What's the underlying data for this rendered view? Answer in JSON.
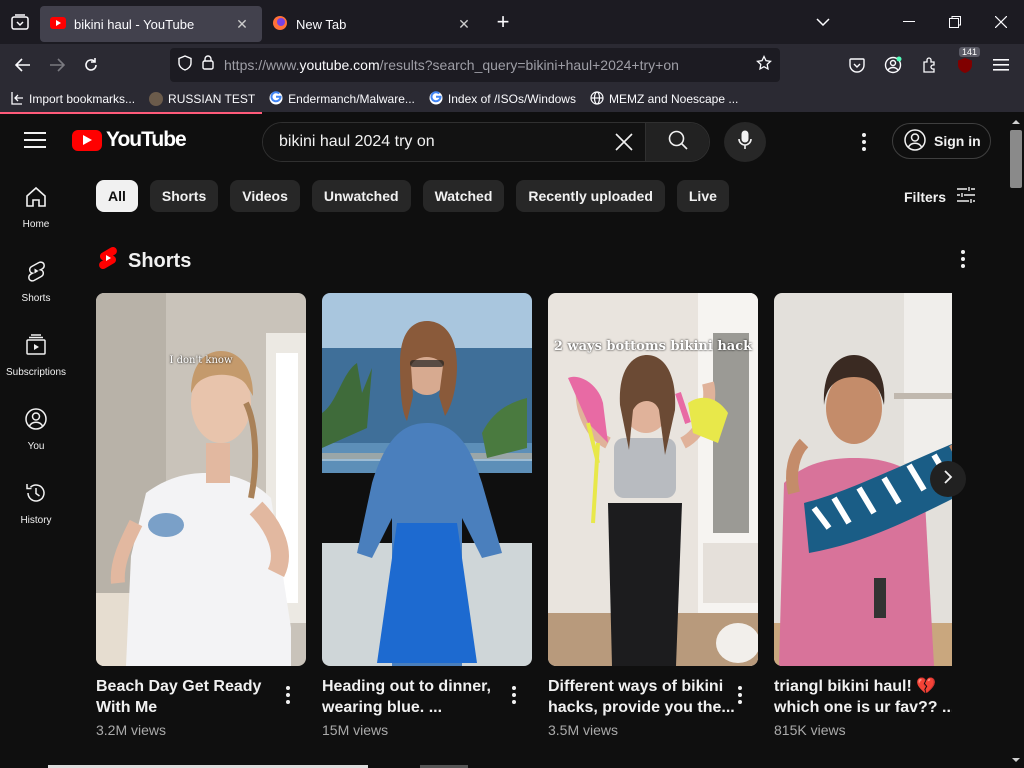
{
  "browser": {
    "tabs": [
      {
        "title": "bikini haul - YouTube",
        "active": true,
        "icon": "youtube-favicon"
      },
      {
        "title": "New Tab",
        "active": false,
        "icon": "firefox-favicon"
      }
    ],
    "url_prefix": "https://www.",
    "url_domain": "youtube.com",
    "url_rest": "/results?search_query=bikini+haul+2024+try+on",
    "extension_badge": "141",
    "bookmarks": [
      {
        "label": "Import bookmarks...",
        "icon": "import-icon"
      },
      {
        "label": "RUSSIAN TEST",
        "icon": "user-favicon"
      },
      {
        "label": "Endermanch/Malware...",
        "icon": "google-favicon"
      },
      {
        "label": "Index of /ISOs/Windows",
        "icon": "google-favicon"
      },
      {
        "label": "MEMZ and Noescape ...",
        "icon": "globe-icon"
      }
    ]
  },
  "youtube": {
    "logo_text": "YouTube",
    "search_value": "bikini haul 2024 try on",
    "sign_in_label": "Sign in",
    "sidebar": [
      {
        "label": "Home",
        "icon": "home-icon"
      },
      {
        "label": "Shorts",
        "icon": "shorts-icon"
      },
      {
        "label": "Subscriptions",
        "icon": "subscriptions-icon"
      },
      {
        "label": "You",
        "icon": "you-icon"
      },
      {
        "label": "History",
        "icon": "history-icon"
      }
    ],
    "chips": [
      "All",
      "Shorts",
      "Videos",
      "Unwatched",
      "Watched",
      "Recently uploaded",
      "Live"
    ],
    "filters_label": "Filters",
    "shorts_heading": "Shorts",
    "shorts": [
      {
        "title": "Beach Day Get Ready With Me",
        "views": "3.2M views",
        "overlay": "I don't know"
      },
      {
        "title": "Heading out to dinner, wearing blue. ...",
        "views": "15M views",
        "overlay": ""
      },
      {
        "title": "Different ways of bikini hacks, provide you the...",
        "views": "3.5M views",
        "overlay": "2 ways bottoms bikini hack"
      },
      {
        "title": "triangl bikini haul! 💔 which one is ur fav?? ...",
        "views": "815K views",
        "overlay": ""
      }
    ],
    "colors": {
      "brand_red": "#ff0000",
      "bg": "#0f0f0f",
      "chip_bg": "#272727"
    }
  }
}
